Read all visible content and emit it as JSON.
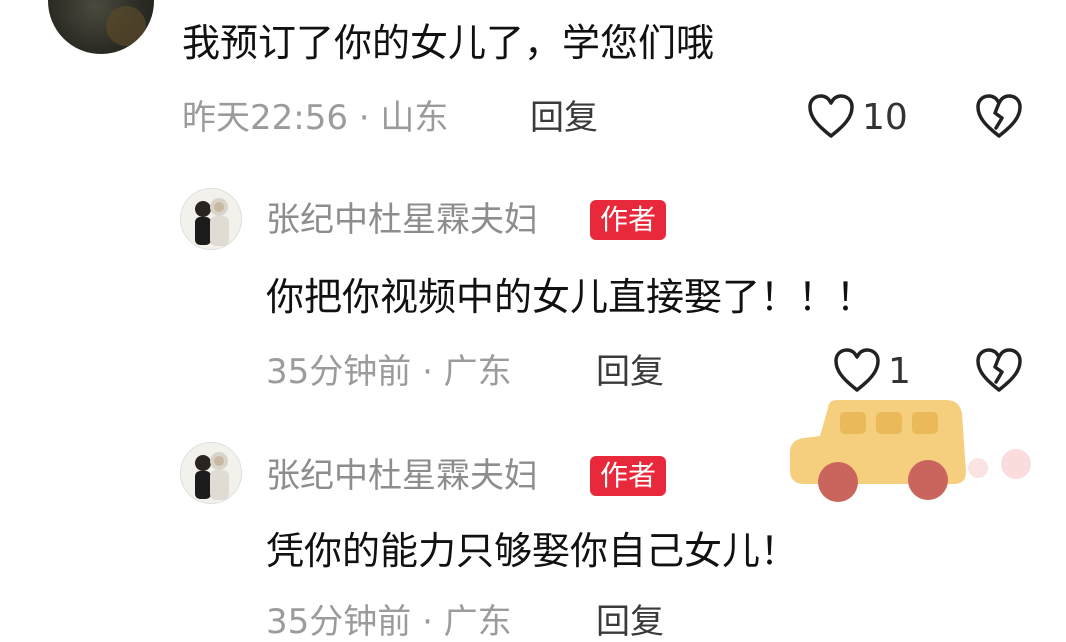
{
  "comments": [
    {
      "text": "我预订了你的女儿了，学您们哦",
      "time_location": "昨天22:56 · 山东",
      "reply_label": "回复",
      "like_count": "10"
    },
    {
      "username": "张纪中杜星霖夫妇",
      "badge": "作者",
      "text": "你把你视频中的女儿直接娶了！！！",
      "time_location": "35分钟前 · 广东",
      "reply_label": "回复",
      "like_count": "1"
    },
    {
      "username": "张纪中杜星霖夫妇",
      "badge": "作者",
      "text": "凭你的能力只够娶你自己女儿！",
      "time_location": "35分钟前 · 广东",
      "reply_label": "回复"
    }
  ],
  "icons": {
    "like": "heart-outline-icon",
    "dislike": "broken-heart-icon",
    "sticker": "school-bus-sticker"
  },
  "colors": {
    "author_badge": "#e8293b",
    "sticker_bus": "#f5cf7e",
    "sticker_wheel": "#c9655d"
  }
}
